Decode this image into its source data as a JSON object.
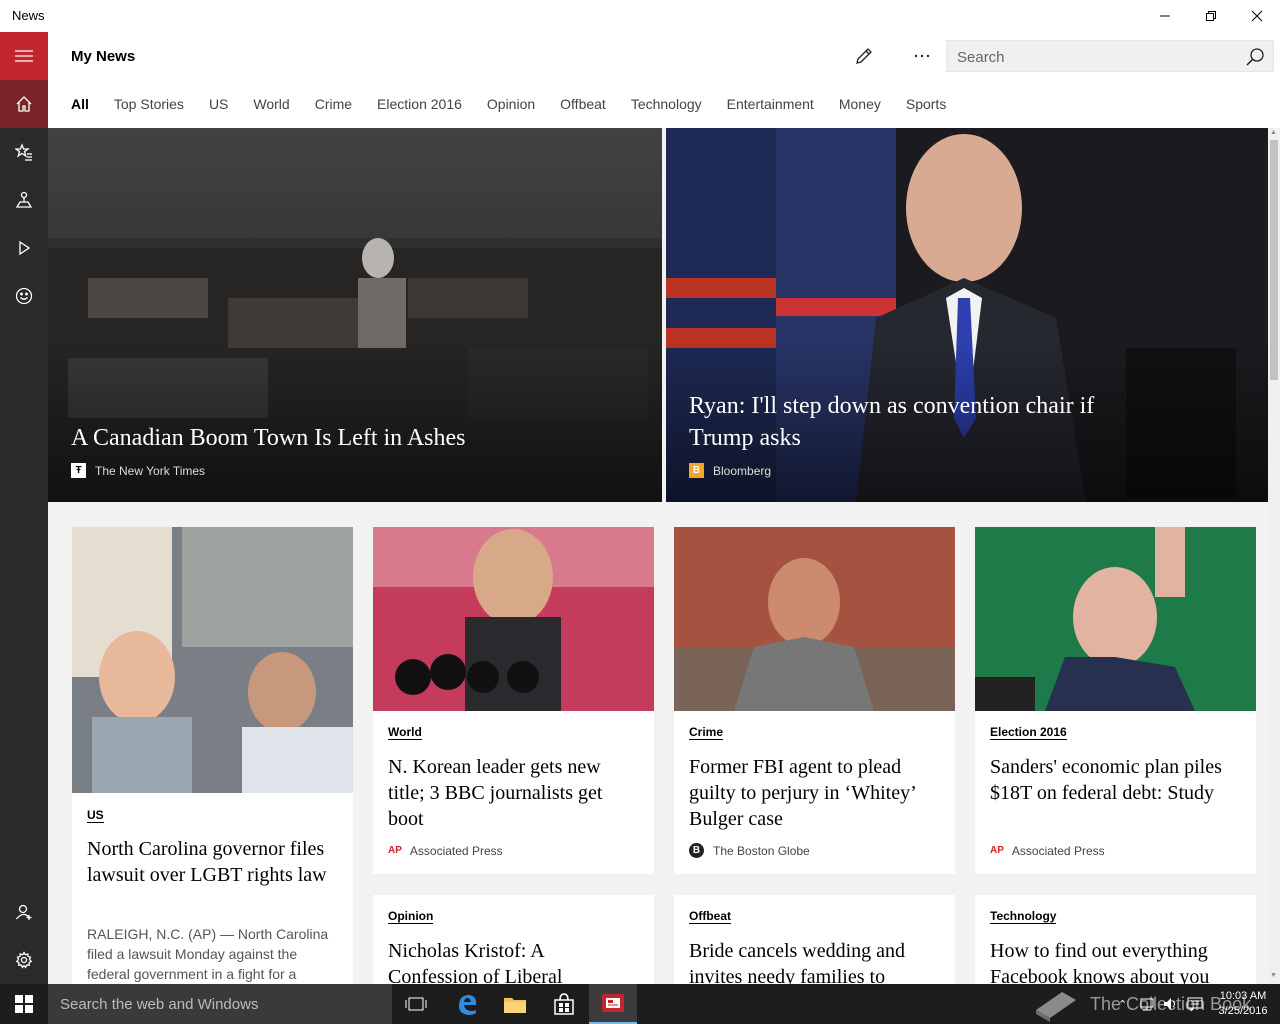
{
  "window": {
    "title": "News"
  },
  "header": {
    "title": "My News",
    "search_placeholder": "Search"
  },
  "tabs": [
    {
      "label": "All",
      "active": true
    },
    {
      "label": "Top Stories"
    },
    {
      "label": "US"
    },
    {
      "label": "World"
    },
    {
      "label": "Crime"
    },
    {
      "label": "Election 2016"
    },
    {
      "label": "Opinion"
    },
    {
      "label": "Offbeat"
    },
    {
      "label": "Technology"
    },
    {
      "label": "Entertainment"
    },
    {
      "label": "Money"
    },
    {
      "label": "Sports"
    }
  ],
  "sidebar": {
    "items": [
      {
        "icon": "hamburger-icon"
      },
      {
        "icon": "home-icon"
      },
      {
        "icon": "interests-star-icon"
      },
      {
        "icon": "local-icon"
      },
      {
        "icon": "video-play-icon"
      },
      {
        "icon": "smiley-icon"
      },
      {
        "icon": "sign-in-person-icon"
      },
      {
        "icon": "gear-icon"
      }
    ]
  },
  "hero": [
    {
      "title": "A Canadian Boom Town Is Left in Ashes",
      "source": "The New York Times",
      "logo": "Ŧ"
    },
    {
      "title": "Ryan: I'll step down as convention chair if Trump asks",
      "source": "Bloomberg",
      "logo": "B",
      "logo_color": "#f5a623"
    }
  ],
  "cards": [
    {
      "category": "US",
      "title": "North Carolina governor files lawsuit over LGBT rights law",
      "snippet": "RALEIGH, N.C. (AP) — North Carolina filed a lawsuit Monday against the federal government in a fight for a"
    },
    {
      "category": "World",
      "title": "N. Korean leader gets new title; 3 BBC journalists get boot",
      "source": "Associated Press",
      "logo": "AP"
    },
    {
      "category": "Crime",
      "title": "Former FBI agent to plead guilty to perjury in ‘Whitey’ Bulger case",
      "source": "The Boston Globe",
      "logo": "B"
    },
    {
      "category": "Election 2016",
      "title": "Sanders' economic plan piles $18T on federal debt: Study",
      "source": "Associated Press",
      "logo": "AP"
    },
    {
      "category": "Opinion",
      "title": "Nicholas Kristof: A Confession of Liberal"
    },
    {
      "category": "Offbeat",
      "title": "Bride cancels wedding and invites needy families to"
    },
    {
      "category": "Technology",
      "title": "How to find out everything Facebook knows about you"
    }
  ],
  "taskbar": {
    "search_placeholder": "Search the web and Windows",
    "watermark": "The Collection Book",
    "time": "10:03 AM",
    "date": "3/25/2016"
  },
  "colors": {
    "accent": "#c4262e",
    "sidebar": "#2b2b2b",
    "taskbar": "#1d1d1d"
  }
}
